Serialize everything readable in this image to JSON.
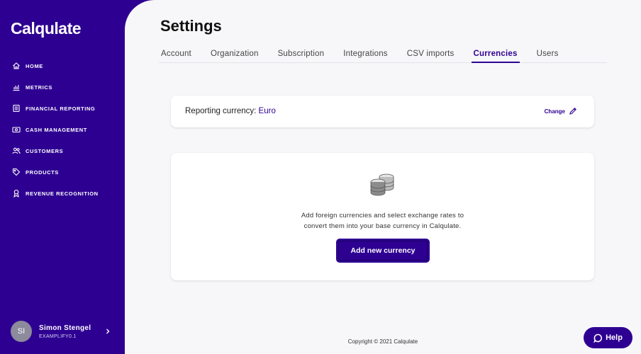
{
  "app": {
    "logo_text": "Calqulate"
  },
  "sidebar": {
    "items": [
      {
        "label": "HOME",
        "icon": "home-icon"
      },
      {
        "label": "METRICS",
        "icon": "bar-chart-icon"
      },
      {
        "label": "FINANCIAL REPORTING",
        "icon": "document-icon"
      },
      {
        "label": "CASH MANAGEMENT",
        "icon": "cash-icon"
      },
      {
        "label": "CUSTOMERS",
        "icon": "users-icon"
      },
      {
        "label": "PRODUCTS",
        "icon": "tag-icon"
      },
      {
        "label": "REVENUE RECOGNITION",
        "icon": "award-icon"
      }
    ],
    "user": {
      "initials": "SI",
      "name": "Simon Stengel",
      "org": "EXAMPLIFY0.1"
    }
  },
  "page": {
    "title": "Settings",
    "tabs": [
      {
        "label": "Account",
        "active": false
      },
      {
        "label": "Organization",
        "active": false
      },
      {
        "label": "Subscription",
        "active": false
      },
      {
        "label": "Integrations",
        "active": false
      },
      {
        "label": "CSV imports",
        "active": false
      },
      {
        "label": "Currencies",
        "active": true
      },
      {
        "label": "Users",
        "active": false
      }
    ]
  },
  "reporting": {
    "label": "Reporting currency: ",
    "value": "Euro",
    "change_label": "Change"
  },
  "currency_card": {
    "icon": "coins-icon",
    "description_line1": "Add foreign currencies and select exchange rates to",
    "description_line2": "convert them into your base currency in Calqulate.",
    "add_button": "Add new currency"
  },
  "footer": {
    "copyright": "Copyright © 2021 Calqulate"
  },
  "help": {
    "label": "Help"
  },
  "colors": {
    "brand": "#2e0092",
    "background": "#f7f7f9",
    "card": "#ffffff"
  }
}
